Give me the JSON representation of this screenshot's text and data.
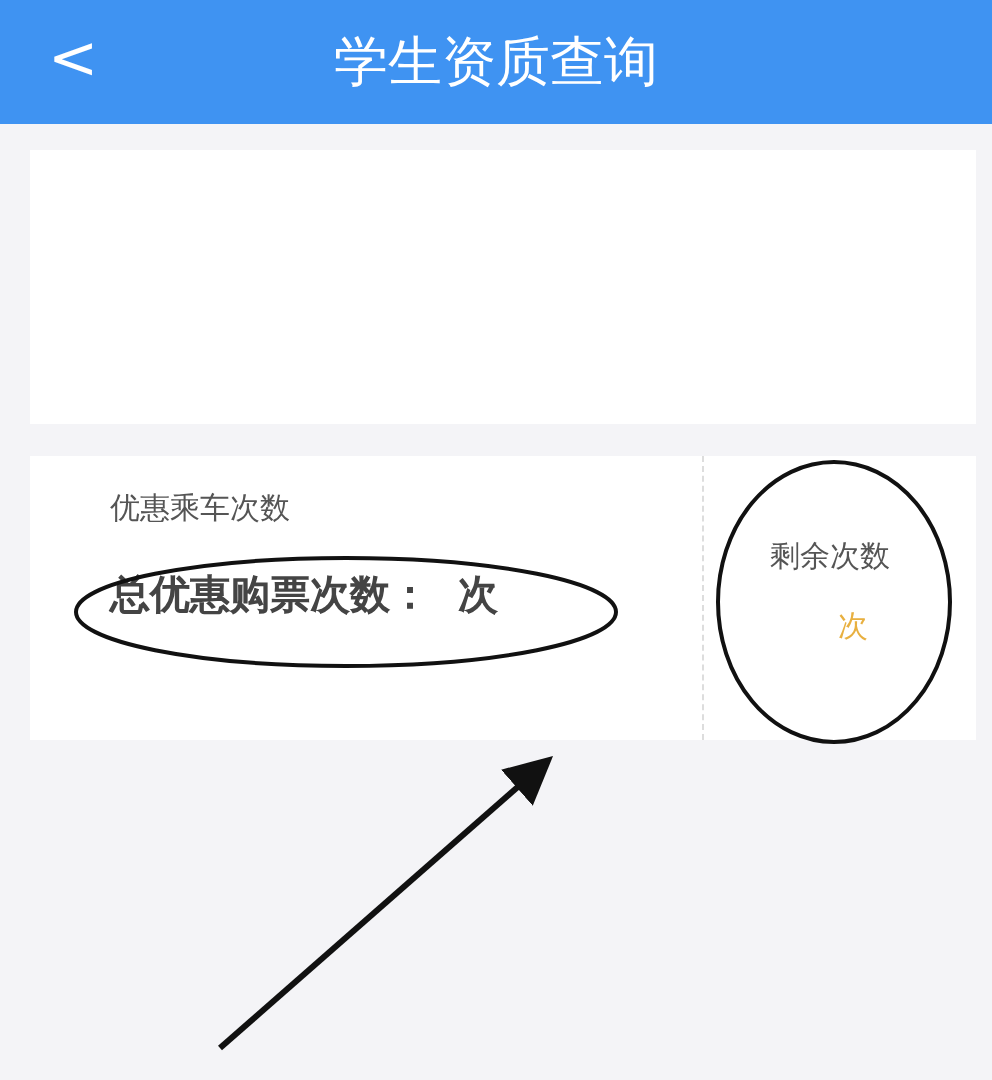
{
  "header": {
    "back_icon": "<",
    "title": "学生资质查询"
  },
  "discount": {
    "label": "优惠乘车次数",
    "total": "总优惠购票次数：  次"
  },
  "remaining": {
    "label": "剩余次数",
    "value": "次"
  }
}
